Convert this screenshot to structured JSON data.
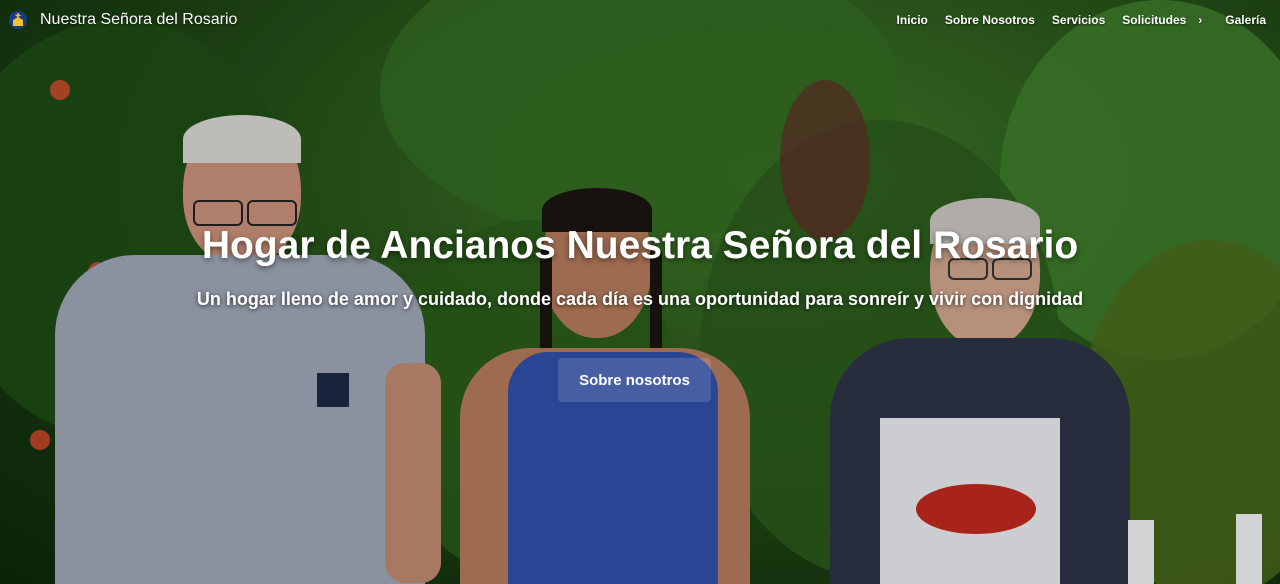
{
  "brand": {
    "name": "Nuestra Señora del Rosario",
    "logo_icon": "church-logo-icon"
  },
  "nav": {
    "items": [
      {
        "label": "Inicio"
      },
      {
        "label": "Sobre Nosotros"
      },
      {
        "label": "Servicios"
      },
      {
        "label": "Solicitudes"
      },
      {
        "label": "Galería"
      }
    ],
    "chevron_icon": "chevron-right-icon"
  },
  "hero": {
    "title": "Hogar de Ancianos Nuestra Señora del Rosario",
    "subtitle": "Un hogar lleno de amor y cuidado, donde cada día es una oportunidad para sonreír y vivir con dignidad",
    "button_label": "Sobre nosotros"
  },
  "colors": {
    "text": "#ffffff",
    "foliage_dark": "#173a10",
    "foliage_light": "#3f7a2a"
  }
}
